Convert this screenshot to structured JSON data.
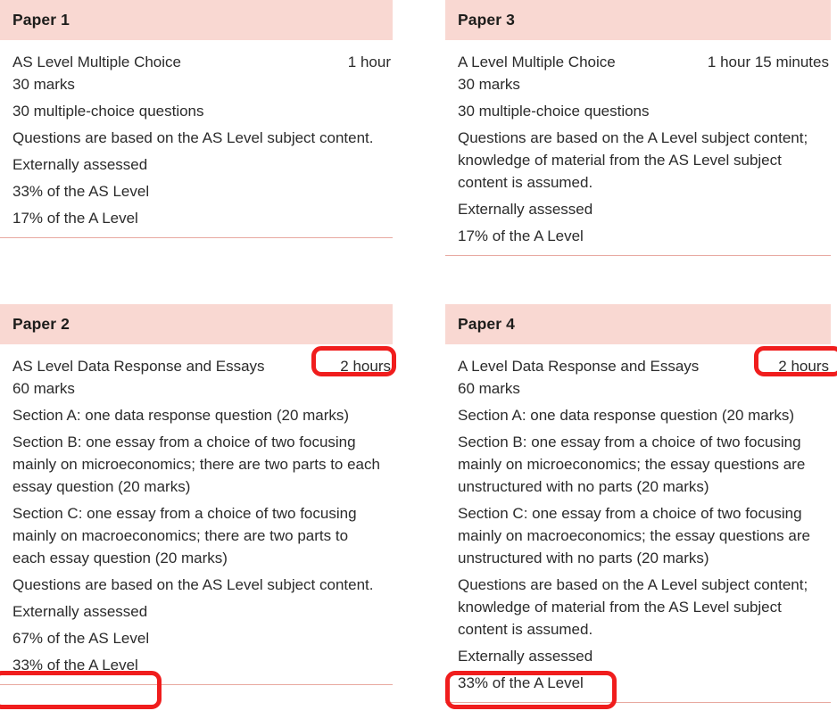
{
  "colors": {
    "header_bg": "#f9d8d2",
    "divider": "#e8a9a0",
    "text": "#2b2b2b",
    "highlight_red": "#f01d1d",
    "page_bg": "#ffffff"
  },
  "papers": [
    {
      "id": "paper-1",
      "title": "Paper 1",
      "subject_line": "AS Level Multiple Choice",
      "duration": "1 hour",
      "duration_highlighted": false,
      "lines": [
        {
          "text": "30 marks",
          "highlighted": false
        },
        {
          "text": "30 multiple-choice questions",
          "highlighted": false
        },
        {
          "text": "Questions are based on the AS Level subject content.",
          "highlighted": false
        },
        {
          "text": "Externally assessed",
          "highlighted": false
        },
        {
          "text": "33% of the AS Level",
          "highlighted": false
        },
        {
          "text": "17% of the A Level",
          "highlighted": false
        }
      ]
    },
    {
      "id": "paper-2",
      "title": "Paper 2",
      "subject_line": "AS Level Data Response and Essays",
      "duration": "2 hours",
      "duration_highlighted": true,
      "lines": [
        {
          "text": "60 marks",
          "highlighted": false
        },
        {
          "text": "Section A: one data response question (20 marks)",
          "highlighted": false
        },
        {
          "text": "Section B: one essay from a choice of two focusing mainly on microeconomics; there are two parts to each essay question (20 marks)",
          "highlighted": false
        },
        {
          "text": "Section C: one essay from a choice of two focusing mainly on macroeconomics; there are two parts to each essay question (20 marks)",
          "highlighted": false
        },
        {
          "text": "Questions are based on the AS Level subject content.",
          "highlighted": false
        },
        {
          "text": "Externally assessed",
          "highlighted": false
        },
        {
          "text": "67% of the AS Level",
          "highlighted": false
        },
        {
          "text": "33% of the A Level",
          "highlighted": true
        }
      ]
    },
    {
      "id": "paper-3",
      "title": "Paper 3",
      "subject_line": "A Level Multiple Choice",
      "duration": "1 hour 15 minutes",
      "duration_highlighted": false,
      "lines": [
        {
          "text": "30 marks",
          "highlighted": false
        },
        {
          "text": "30 multiple-choice questions",
          "highlighted": false
        },
        {
          "text": "Questions are based on the A Level subject content; knowledge of material from the AS Level subject content is assumed.",
          "highlighted": false
        },
        {
          "text": "Externally assessed",
          "highlighted": false
        },
        {
          "text": "17% of the A Level",
          "highlighted": false
        }
      ]
    },
    {
      "id": "paper-4",
      "title": "Paper 4",
      "subject_line": "A Level Data Response and Essays",
      "duration": "2 hours",
      "duration_highlighted": true,
      "lines": [
        {
          "text": "60 marks",
          "highlighted": false
        },
        {
          "text": "Section A: one data response question (20 marks)",
          "highlighted": false
        },
        {
          "text": "Section B: one essay from a choice of two focusing mainly on microeconomics; the essay questions are unstructured with no parts (20 marks)",
          "highlighted": false
        },
        {
          "text": "Section C: one essay from a choice of two focusing mainly on macroeconomics; the essay questions are unstructured with no parts (20 marks)",
          "highlighted": false
        },
        {
          "text": "Questions are based on the A Level subject content; knowledge of material from the AS Level subject content is assumed.",
          "highlighted": false
        },
        {
          "text": "Externally assessed",
          "highlighted": false
        },
        {
          "text": "33% of the A Level",
          "highlighted": true
        }
      ]
    }
  ]
}
